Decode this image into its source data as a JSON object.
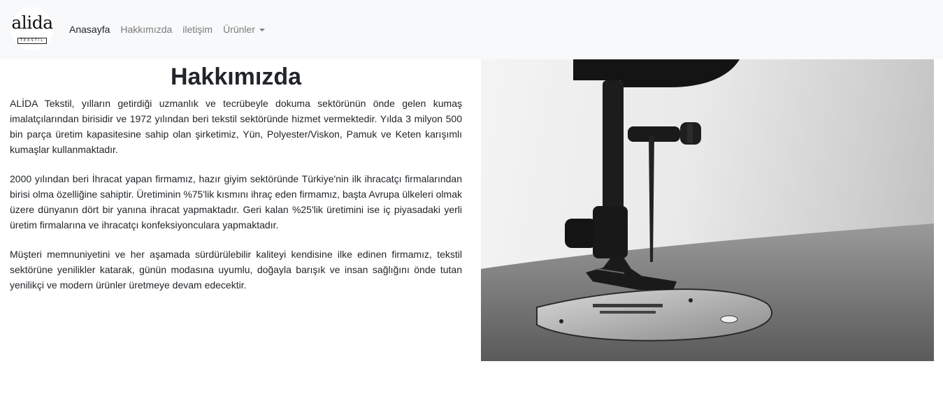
{
  "brand": {
    "name": "alida",
    "sub": "TEKSTIL"
  },
  "nav": {
    "items": [
      {
        "label": "Anasayfa",
        "active": true
      },
      {
        "label": "Hakkımızda",
        "active": false
      },
      {
        "label": "iletişim",
        "active": false
      },
      {
        "label": "Ürünler",
        "active": false,
        "dropdown": true
      }
    ]
  },
  "about": {
    "title": "Hakkımızda",
    "paragraphs": [
      "ALİDA Tekstil, yılların getirdiği uzmanlık ve tecrübeyle dokuma sektörünün önde gelen kumaş imalatçılarından birisidir ve 1972 yılından beri tekstil sektöründe hizmet vermektedir. Yılda 3 milyon 500 bin parça üretim kapasitesine sahip olan şirketimiz, Yün, Polyester/Viskon, Pamuk ve Keten karışımlı kumaşlar kullanmaktadır.",
      "2000 yılından beri İhracat yapan firmamız, hazır giyim sektöründe Türkiye'nin ilk ihracatçı firmalarından birisi olma özelliğine sahiptir. Üretiminin %75'lik kısmını ihraç eden firmamız, başta Avrupa ülkeleri olmak üzere dünyanın dört bir yanına ihracat yapmaktadır. Geri kalan %25'lik üretimini ise iç piyasadaki yerli üretim firmalarına ve ihracatçı konfeksiyonculara yapmaktadır.",
      "Müşteri memnuniyetini ve her aşamada sürdürülebilir kaliteyi kendisine ilke edinen firmamız, tekstil sektörüne yenilikler katarak, günün modasına uyumlu, doğayla barışık ve insan sağlığını önde tutan yenilikçi ve modern ürünler üretmeye devam edecektir."
    ]
  },
  "colors": {
    "navbar_bg": "#f8f9fa",
    "nav_active": "#212529",
    "nav_inactive": "#7b7b7b"
  },
  "icons": {
    "dropdown": "caret-down-icon",
    "hero": "sewing-machine-photo"
  }
}
